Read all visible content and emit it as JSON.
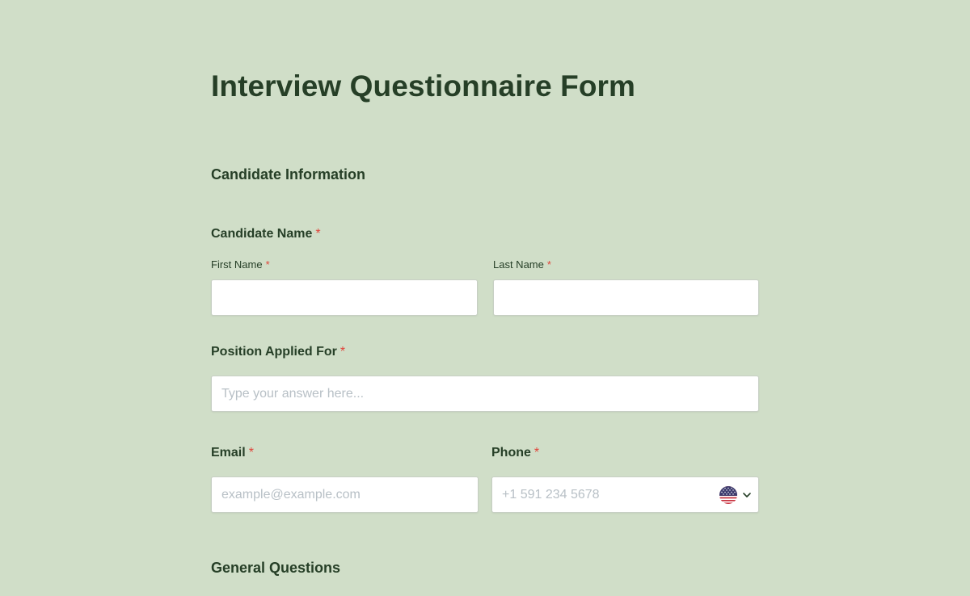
{
  "form": {
    "title": "Interview Questionnaire Form",
    "sections": {
      "candidate_info": "Candidate Information",
      "general_questions": "General Questions"
    },
    "candidate_name": {
      "label": "Candidate Name",
      "required_mark": "*",
      "first_name_label": "First Name",
      "last_name_label": "Last Name",
      "first_name_value": "",
      "last_name_value": ""
    },
    "position": {
      "label": "Position Applied For",
      "required_mark": "*",
      "placeholder": "Type your answer here...",
      "value": ""
    },
    "email": {
      "label": "Email",
      "required_mark": "*",
      "placeholder": "example@example.com",
      "value": ""
    },
    "phone": {
      "label": "Phone",
      "required_mark": "*",
      "placeholder": "+1 591 234 5678",
      "value": "",
      "country_icon": "us-flag-icon",
      "dropdown_icon": "chevron-down-icon"
    }
  },
  "colors": {
    "background": "#d0dec8",
    "text": "#263f27",
    "required": "#e0443a",
    "placeholder": "#b8c0c6"
  }
}
